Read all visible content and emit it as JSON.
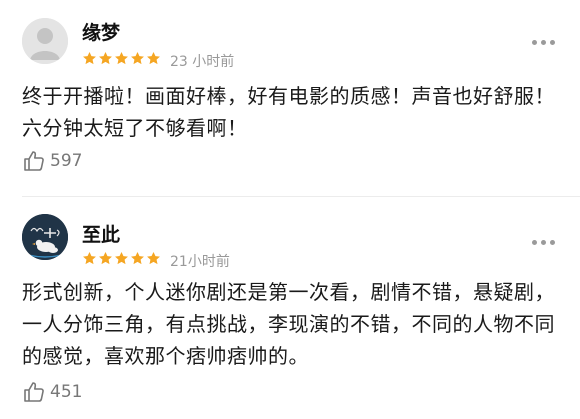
{
  "comments": [
    {
      "user": "缘梦",
      "avatar": "default-gray-avatar",
      "rating": 5,
      "time": "23 小时前",
      "text": "终于开播啦！画面好棒，好有电影的质感！声音也好舒服！六分钟太短了不够看啊！",
      "likes": "597"
    },
    {
      "user": "至此",
      "avatar": "duck-avatar",
      "rating": 5,
      "time": "21小时前",
      "text": "形式创新，个人迷你剧还是第一次看，剧情不错，悬疑剧，一人分饰三角，有点挑战，李现演的不错，不同的人物不同的感觉，喜欢那个痞帅痞帅的。",
      "likes": "451"
    }
  ],
  "colors": {
    "star": "#f5a623",
    "muted": "#999999",
    "icon": "#777777"
  }
}
